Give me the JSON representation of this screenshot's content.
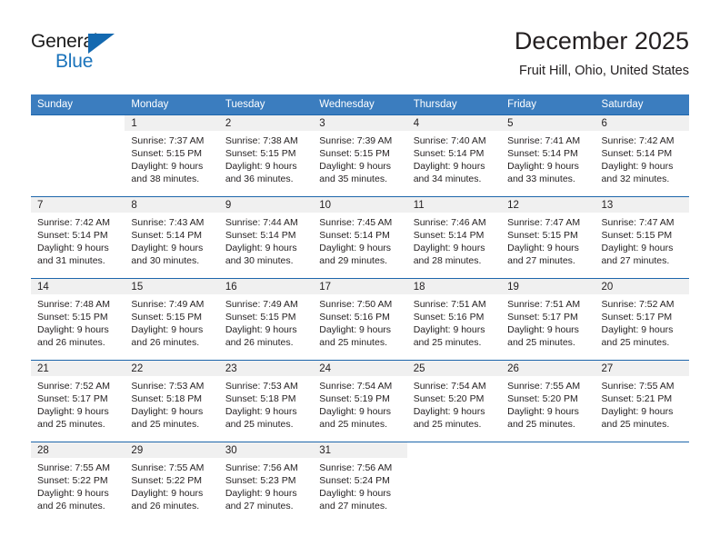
{
  "logo": {
    "word1": "General",
    "word2": "Blue",
    "triangle_color": "#1469b0",
    "blue_text_color": "#1a73bb"
  },
  "header": {
    "title": "December 2025",
    "subtitle": "Fruit Hill, Ohio, United States"
  },
  "theme": {
    "header_row_bg": "#3b7dbf",
    "header_row_text": "#ffffff",
    "row_divider": "#1d66ab",
    "daynum_band_bg": "#f0f0f0",
    "body_text": "#231f20"
  },
  "weekdays": [
    "Sunday",
    "Monday",
    "Tuesday",
    "Wednesday",
    "Thursday",
    "Friday",
    "Saturday"
  ],
  "weeks": [
    [
      {
        "day": "",
        "lines": []
      },
      {
        "day": "1",
        "lines": [
          "Sunrise: 7:37 AM",
          "Sunset: 5:15 PM",
          "Daylight: 9 hours",
          "and 38 minutes."
        ]
      },
      {
        "day": "2",
        "lines": [
          "Sunrise: 7:38 AM",
          "Sunset: 5:15 PM",
          "Daylight: 9 hours",
          "and 36 minutes."
        ]
      },
      {
        "day": "3",
        "lines": [
          "Sunrise: 7:39 AM",
          "Sunset: 5:15 PM",
          "Daylight: 9 hours",
          "and 35 minutes."
        ]
      },
      {
        "day": "4",
        "lines": [
          "Sunrise: 7:40 AM",
          "Sunset: 5:14 PM",
          "Daylight: 9 hours",
          "and 34 minutes."
        ]
      },
      {
        "day": "5",
        "lines": [
          "Sunrise: 7:41 AM",
          "Sunset: 5:14 PM",
          "Daylight: 9 hours",
          "and 33 minutes."
        ]
      },
      {
        "day": "6",
        "lines": [
          "Sunrise: 7:42 AM",
          "Sunset: 5:14 PM",
          "Daylight: 9 hours",
          "and 32 minutes."
        ]
      }
    ],
    [
      {
        "day": "7",
        "lines": [
          "Sunrise: 7:42 AM",
          "Sunset: 5:14 PM",
          "Daylight: 9 hours",
          "and 31 minutes."
        ]
      },
      {
        "day": "8",
        "lines": [
          "Sunrise: 7:43 AM",
          "Sunset: 5:14 PM",
          "Daylight: 9 hours",
          "and 30 minutes."
        ]
      },
      {
        "day": "9",
        "lines": [
          "Sunrise: 7:44 AM",
          "Sunset: 5:14 PM",
          "Daylight: 9 hours",
          "and 30 minutes."
        ]
      },
      {
        "day": "10",
        "lines": [
          "Sunrise: 7:45 AM",
          "Sunset: 5:14 PM",
          "Daylight: 9 hours",
          "and 29 minutes."
        ]
      },
      {
        "day": "11",
        "lines": [
          "Sunrise: 7:46 AM",
          "Sunset: 5:14 PM",
          "Daylight: 9 hours",
          "and 28 minutes."
        ]
      },
      {
        "day": "12",
        "lines": [
          "Sunrise: 7:47 AM",
          "Sunset: 5:15 PM",
          "Daylight: 9 hours",
          "and 27 minutes."
        ]
      },
      {
        "day": "13",
        "lines": [
          "Sunrise: 7:47 AM",
          "Sunset: 5:15 PM",
          "Daylight: 9 hours",
          "and 27 minutes."
        ]
      }
    ],
    [
      {
        "day": "14",
        "lines": [
          "Sunrise: 7:48 AM",
          "Sunset: 5:15 PM",
          "Daylight: 9 hours",
          "and 26 minutes."
        ]
      },
      {
        "day": "15",
        "lines": [
          "Sunrise: 7:49 AM",
          "Sunset: 5:15 PM",
          "Daylight: 9 hours",
          "and 26 minutes."
        ]
      },
      {
        "day": "16",
        "lines": [
          "Sunrise: 7:49 AM",
          "Sunset: 5:15 PM",
          "Daylight: 9 hours",
          "and 26 minutes."
        ]
      },
      {
        "day": "17",
        "lines": [
          "Sunrise: 7:50 AM",
          "Sunset: 5:16 PM",
          "Daylight: 9 hours",
          "and 25 minutes."
        ]
      },
      {
        "day": "18",
        "lines": [
          "Sunrise: 7:51 AM",
          "Sunset: 5:16 PM",
          "Daylight: 9 hours",
          "and 25 minutes."
        ]
      },
      {
        "day": "19",
        "lines": [
          "Sunrise: 7:51 AM",
          "Sunset: 5:17 PM",
          "Daylight: 9 hours",
          "and 25 minutes."
        ]
      },
      {
        "day": "20",
        "lines": [
          "Sunrise: 7:52 AM",
          "Sunset: 5:17 PM",
          "Daylight: 9 hours",
          "and 25 minutes."
        ]
      }
    ],
    [
      {
        "day": "21",
        "lines": [
          "Sunrise: 7:52 AM",
          "Sunset: 5:17 PM",
          "Daylight: 9 hours",
          "and 25 minutes."
        ]
      },
      {
        "day": "22",
        "lines": [
          "Sunrise: 7:53 AM",
          "Sunset: 5:18 PM",
          "Daylight: 9 hours",
          "and 25 minutes."
        ]
      },
      {
        "day": "23",
        "lines": [
          "Sunrise: 7:53 AM",
          "Sunset: 5:18 PM",
          "Daylight: 9 hours",
          "and 25 minutes."
        ]
      },
      {
        "day": "24",
        "lines": [
          "Sunrise: 7:54 AM",
          "Sunset: 5:19 PM",
          "Daylight: 9 hours",
          "and 25 minutes."
        ]
      },
      {
        "day": "25",
        "lines": [
          "Sunrise: 7:54 AM",
          "Sunset: 5:20 PM",
          "Daylight: 9 hours",
          "and 25 minutes."
        ]
      },
      {
        "day": "26",
        "lines": [
          "Sunrise: 7:55 AM",
          "Sunset: 5:20 PM",
          "Daylight: 9 hours",
          "and 25 minutes."
        ]
      },
      {
        "day": "27",
        "lines": [
          "Sunrise: 7:55 AM",
          "Sunset: 5:21 PM",
          "Daylight: 9 hours",
          "and 25 minutes."
        ]
      }
    ],
    [
      {
        "day": "28",
        "lines": [
          "Sunrise: 7:55 AM",
          "Sunset: 5:22 PM",
          "Daylight: 9 hours",
          "and 26 minutes."
        ]
      },
      {
        "day": "29",
        "lines": [
          "Sunrise: 7:55 AM",
          "Sunset: 5:22 PM",
          "Daylight: 9 hours",
          "and 26 minutes."
        ]
      },
      {
        "day": "30",
        "lines": [
          "Sunrise: 7:56 AM",
          "Sunset: 5:23 PM",
          "Daylight: 9 hours",
          "and 27 minutes."
        ]
      },
      {
        "day": "31",
        "lines": [
          "Sunrise: 7:56 AM",
          "Sunset: 5:24 PM",
          "Daylight: 9 hours",
          "and 27 minutes."
        ]
      },
      {
        "day": "",
        "lines": []
      },
      {
        "day": "",
        "lines": []
      },
      {
        "day": "",
        "lines": []
      }
    ]
  ]
}
